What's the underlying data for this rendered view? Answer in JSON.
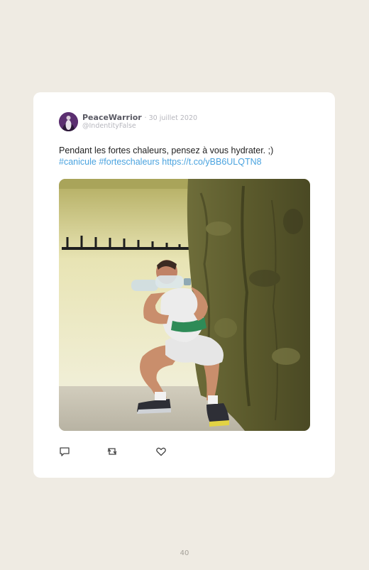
{
  "tweet": {
    "author": {
      "display_name": "PeaceWarrior",
      "handle": "@IndentityFalse",
      "avatar_icon": "peace-warrior-avatar"
    },
    "date": "· 30 juillet 2020",
    "text_line1": "Pendant les fortes chaleurs, pensez à vous hydrater. ;)",
    "hashtag1": "#canicule",
    "hashtag2": "#forteschaleurs",
    "link": "https://t.co/yBB6ULQTN8",
    "media_icon": "photo-man-squatting-holding-water-bottle",
    "actions": [
      {
        "name": "reply",
        "icon": "reply-icon"
      },
      {
        "name": "retweet",
        "icon": "retweet-icon"
      },
      {
        "name": "like",
        "icon": "heart-icon"
      }
    ]
  },
  "colors": {
    "background": "#efebe3",
    "card": "#ffffff",
    "link": "#4aa3df",
    "name": "#5a5a64",
    "muted": "#b7b7be"
  },
  "page_number": "40"
}
